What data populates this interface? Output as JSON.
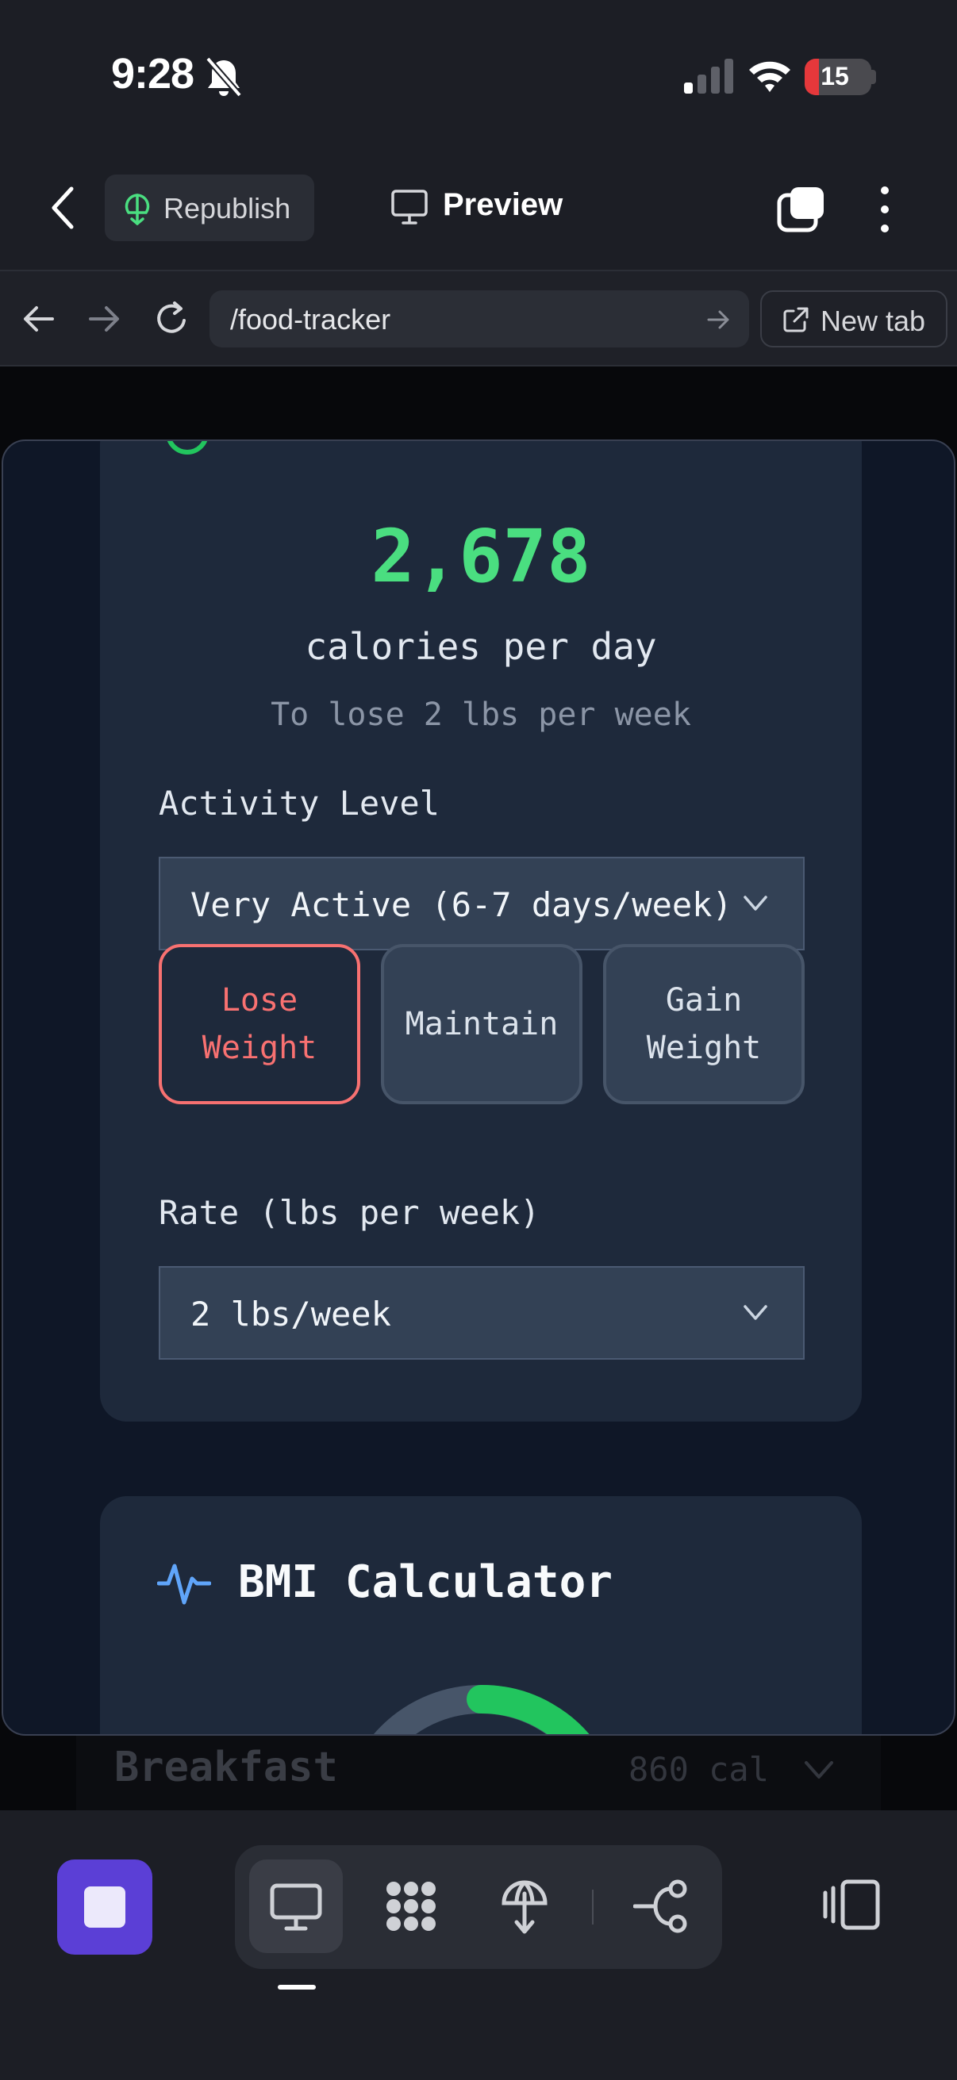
{
  "status_bar": {
    "time": "9:28",
    "battery": "15"
  },
  "toolbar": {
    "republish_label": "Republish",
    "preview_label": "Preview"
  },
  "browser": {
    "url": "/food-tracker",
    "new_tab_label": "New tab"
  },
  "calorie_card": {
    "calories": "2,678",
    "unit": "calories per day",
    "goal_text": "To lose 2 lbs per week",
    "activity_label": "Activity Level",
    "activity_value": "Very Active (6-7 days/week)",
    "goal_buttons": [
      {
        "label": "Lose\nWeight",
        "active": true
      },
      {
        "label": "Maintain",
        "active": false
      },
      {
        "label": "Gain\nWeight",
        "active": false
      }
    ],
    "rate_label": "Rate (lbs per week)",
    "rate_value": "2 lbs/week"
  },
  "bmi_card": {
    "title": "BMI Calculator"
  },
  "behind_row": {
    "title": "Breakfast",
    "calories": "860 cal"
  },
  "colors": {
    "accent_green": "#4ade80",
    "active_red": "#f87171",
    "brand_purple": "#5b3fd6"
  },
  "icons": [
    "bell-slash-icon",
    "signal-icon",
    "wifi-icon",
    "battery-icon",
    "back-chevron-icon",
    "republish-icon",
    "monitor-icon",
    "tabs-icon",
    "more-vertical-icon",
    "arrow-left-icon",
    "arrow-right-icon",
    "reload-icon",
    "external-link-icon",
    "activity-icon",
    "stop-icon",
    "apps-icon",
    "deploy-icon",
    "graph-icon",
    "panel-icon"
  ]
}
